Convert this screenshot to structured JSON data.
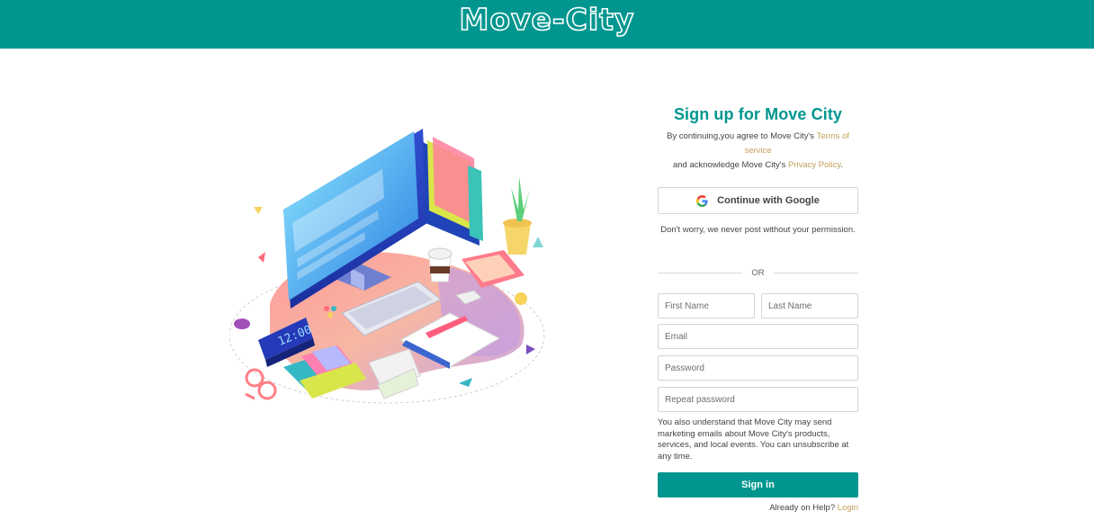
{
  "colors": {
    "brand": "#00968f",
    "link": "#c3a05a",
    "text": "#444444",
    "border": "#d4d4d4"
  },
  "header": {
    "logo_text": "Move-City"
  },
  "form": {
    "title": "Sign up for Move City",
    "terms_prefix": "By continuing,you agree to Move City's ",
    "terms_link": "Terms of service",
    "terms_middle": "and acknowledge Move City's ",
    "privacy_link": "Privacy Policy",
    "terms_suffix": ".",
    "google_icon": "google-g-icon",
    "google_label": "Continue with Google",
    "google_note": "Don't worry, we never post without your permission.",
    "or_label": "OR",
    "fields": {
      "first_name": "First Name",
      "last_name": "Last Name",
      "email": "Email",
      "password": "Password",
      "repeat_password": "Repeat password"
    },
    "marketing_notice": "You also understand that Move City may send marketing emails about Move City's products, services, and local events. You can unsubscribe at any time.",
    "signin_label": "Sign in",
    "already_text": "Already on Help? ",
    "login_link": "Login"
  },
  "illustration": {
    "clock_text": "12:00"
  }
}
